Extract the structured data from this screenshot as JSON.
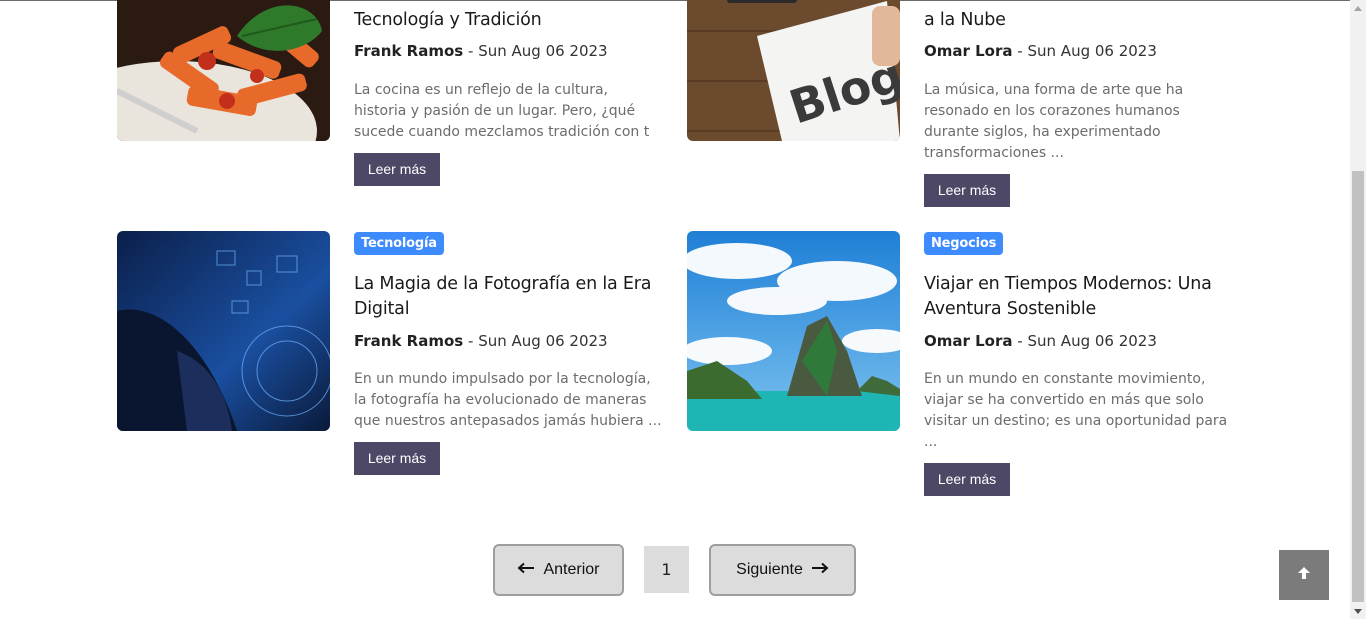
{
  "posts": [
    {
      "title": "Tecnología y Tradición",
      "author": "Frank Ramos",
      "date": "Sun Aug 06 2023",
      "excerpt": "La cocina es un reflejo de la cultura, historia y pasión de un lugar. Pero, ¿qué sucede cuando mezclamos tradición con t ...",
      "button": "Leer más",
      "image": "pasta-dish-image"
    },
    {
      "title": "a la Nube",
      "author": "Omar Lora",
      "date": "Sun Aug 06 2023",
      "excerpt": "La música, una forma de arte que ha resonado en los corazones humanos durante siglos, ha experimentado transformaciones ...",
      "button": "Leer más",
      "image": "blog-notepad-image"
    },
    {
      "category": "Tecnología",
      "title": "La Magia de la Fotografía en la Era Digital",
      "author": "Frank Ramos",
      "date": "Sun Aug 06 2023",
      "excerpt": "En un mundo impulsado por la tecnología, la fotografía ha evolucionado de maneras que nuestros antepasados jamás hubiera ...",
      "button": "Leer más",
      "image": "digital-technology-image"
    },
    {
      "category": "Negocios",
      "title": "Viajar en Tiempos Modernos: Una Aventura Sostenible",
      "author": "Omar Lora",
      "date": "Sun Aug 06 2023",
      "excerpt": "En un mundo en constante movimiento, viajar se ha convertido en más que solo visitar un destino; es una oportunidad para ...",
      "button": "Leer más",
      "image": "tropical-island-image"
    }
  ],
  "meta_separator": "-",
  "pagination": {
    "prev_label": "Anterior",
    "prev_icon": "arrow-left-icon",
    "current_page": "1",
    "next_label": "Siguiente",
    "next_icon": "arrow-right-icon"
  },
  "scroll_to_top_icon": "arrow-up-icon",
  "colors": {
    "badge": "#3d8bfd",
    "read_button": "#4e4867",
    "pager_bg": "#dcdcdc",
    "to_top_bg": "#7b7b7b"
  }
}
